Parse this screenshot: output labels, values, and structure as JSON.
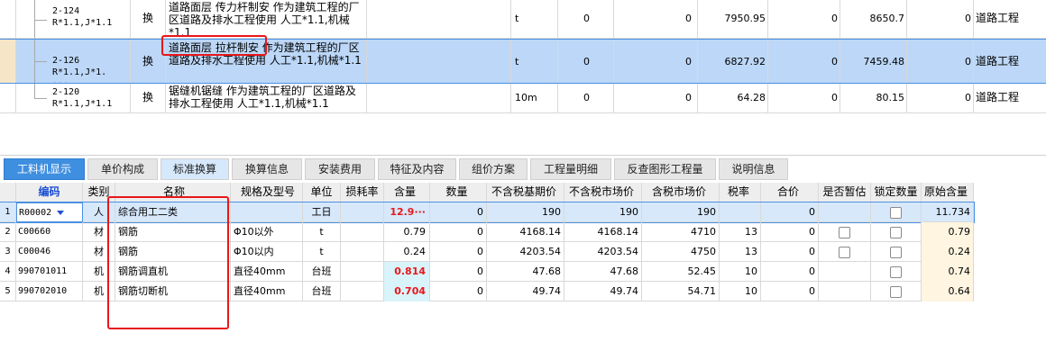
{
  "top_rows": [
    {
      "code": "2-124\nR*1.1,J*1.1",
      "hz": "换",
      "name": "道路面层 传力杆制安  作为建筑工程的厂区道路及排水工程使用 人工*1.1,机械*1.1",
      "unit": "t",
      "n1": "0",
      "n2": "0",
      "n3": "7950.95",
      "n4": "0",
      "n5": "8650.7",
      "n6": "0",
      "type": "道路工程"
    },
    {
      "code": "2-126\nR*1.1,J*1.",
      "code_more": "···",
      "code_tail": "1",
      "hz": "换",
      "name": "道路面层 拉杆制安  作为建筑工程的厂区道路及排水工程使用 人工*1.1,机械*1.1",
      "unit": "t",
      "n1": "0",
      "n2": "0",
      "n3": "6827.92",
      "n4": "0",
      "n5": "7459.48",
      "n6": "0",
      "type": "道路工程"
    },
    {
      "code": "2-120\nR*1.1,J*1.1",
      "hz": "换",
      "name": "锯缝机锯缝  作为建筑工程的厂区道路及排水工程使用 人工*1.1,机械*1.1",
      "unit": "10m",
      "n1": "0",
      "n2": "0",
      "n3": "64.28",
      "n4": "0",
      "n5": "80.15",
      "n6": "0",
      "type": "道路工程"
    }
  ],
  "tabs": [
    "工料机显示",
    "单价构成",
    "标准换算",
    "换算信息",
    "安装费用",
    "特征及内容",
    "组价方案",
    "工程量明细",
    "反查图形工程量",
    "说明信息"
  ],
  "headers": [
    "编码",
    "类别",
    "名称",
    "规格及型号",
    "单位",
    "损耗率",
    "含量",
    "数量",
    "不含税基期价",
    "不含税市场价",
    "含税市场价",
    "税率",
    "合价",
    "是否暂估",
    "锁定数量",
    "原始含量"
  ],
  "rows": [
    {
      "idx": "1",
      "code": "R00002",
      "cat": "人",
      "name": "综合用工二类",
      "spec": "",
      "unit": "工日",
      "loss": "",
      "content": "12.9···",
      "qty": "0",
      "p1": "190",
      "p2": "190",
      "p3": "190",
      "tax": "",
      "total": "0",
      "est": "",
      "lock": "box",
      "orig": "11.734"
    },
    {
      "idx": "2",
      "code": "C00660",
      "cat": "材",
      "name": "钢筋",
      "spec": "Φ10以外",
      "unit": "t",
      "loss": "",
      "content": "0.79",
      "qty": "0",
      "p1": "4168.14",
      "p2": "4168.14",
      "p3": "4710",
      "tax": "13",
      "total": "0",
      "est": "box",
      "lock": "box",
      "orig": "0.79"
    },
    {
      "idx": "3",
      "code": "C00046",
      "cat": "材",
      "name": "钢筋",
      "spec": "Φ10以内",
      "unit": "t",
      "loss": "",
      "content": "0.24",
      "qty": "0",
      "p1": "4203.54",
      "p2": "4203.54",
      "p3": "4750",
      "tax": "13",
      "total": "0",
      "est": "box",
      "lock": "box",
      "orig": "0.24"
    },
    {
      "idx": "4",
      "code": "990701011",
      "cat": "机",
      "name": "钢筋调直机",
      "spec": "直径40mm",
      "unit": "台班",
      "loss": "",
      "content": "0.814",
      "qty": "0",
      "p1": "47.68",
      "p2": "47.68",
      "p3": "52.45",
      "tax": "10",
      "total": "0",
      "est": "",
      "lock": "box",
      "orig": "0.74"
    },
    {
      "idx": "5",
      "code": "990702010",
      "cat": "机",
      "name": "钢筋切断机",
      "spec": "直径40mm",
      "unit": "台班",
      "loss": "",
      "content": "0.704",
      "qty": "0",
      "p1": "49.74",
      "p2": "49.74",
      "p3": "54.71",
      "tax": "10",
      "total": "0",
      "est": "",
      "lock": "box",
      "orig": "0.64"
    }
  ],
  "colors": {
    "accent": "#3f8fe0",
    "highlight": "#e8171a",
    "selection": "#bcd7f7"
  }
}
